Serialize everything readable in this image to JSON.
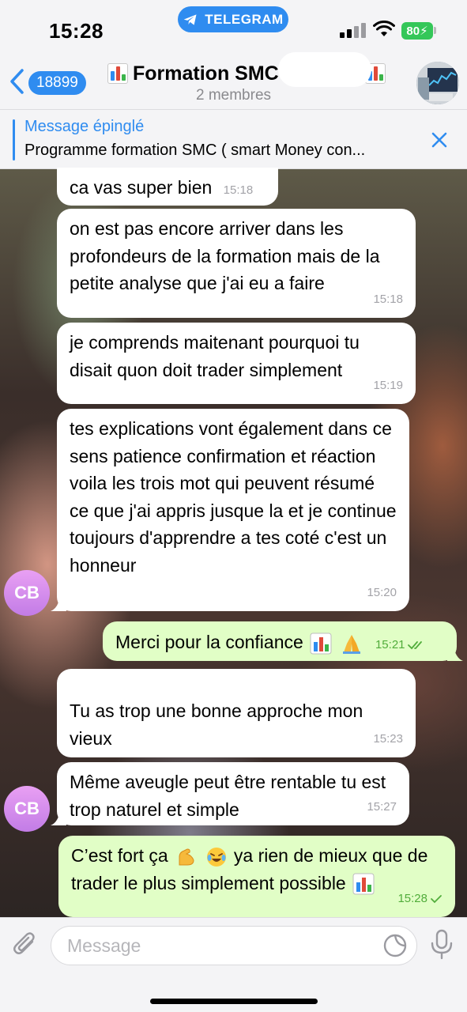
{
  "status_bar": {
    "time": "15:28",
    "app_badge": "TELEGRAM",
    "battery": "80"
  },
  "header": {
    "back_count": "18899",
    "title": "Formation SMC",
    "subtitle": "2 membres"
  },
  "pinned": {
    "title": "Message épinglé",
    "text": "Programme formation SMC ( smart Money con..."
  },
  "messages": [
    {
      "text": "ca vas super bien",
      "time": "15:18",
      "direction": "in"
    },
    {
      "text": "on est pas encore arriver dans les profondeurs de la formation mais de la petite analyse que j'ai eu a faire",
      "time": "15:18",
      "direction": "in"
    },
    {
      "text": "je comprends maitenant pourquoi tu disait quon doit trader simplement",
      "time": "15:19",
      "direction": "in"
    },
    {
      "text": "tes explications vont également dans ce sens patience confirmation et réaction voila les trois mot qui peuvent résumé ce que j'ai appris jusque la et je continue toujours d'apprendre a tes coté c'est un honneur",
      "time": "15:20",
      "direction": "in"
    },
    {
      "text": "Merci pour la confiance",
      "time": "15:21",
      "direction": "out",
      "status": "read"
    },
    {
      "text": "Tu as trop une bonne approche mon vieux",
      "time": "15:23",
      "direction": "in"
    },
    {
      "text": "Même aveugle peut être rentable tu est trop naturel et simple",
      "time": "15:27",
      "direction": "in"
    },
    {
      "text_a": "C’est fort ça",
      "text_b": "ya rien de mieux que de trader le plus simplement possible",
      "time": "15:28",
      "direction": "out",
      "status": "sent"
    }
  ],
  "avatar_initials": "CB",
  "input": {
    "placeholder": "Message"
  },
  "icons": [
    "telegram-icon",
    "signal-icon",
    "wifi-icon",
    "battery-icon",
    "chevron-left-icon",
    "chart-emoji-icon",
    "close-icon",
    "paperclip-icon",
    "sticker-icon",
    "microphone-icon",
    "check-icon",
    "double-check-icon",
    "pray-emoji-icon",
    "muscle-emoji-icon",
    "laugh-emoji-icon"
  ],
  "colors": {
    "accent": "#2f8cf0",
    "outgoing_bubble": "#e1fec6",
    "incoming_bubble": "#ffffff",
    "avatar": "#d48df0",
    "battery": "#34c759"
  }
}
